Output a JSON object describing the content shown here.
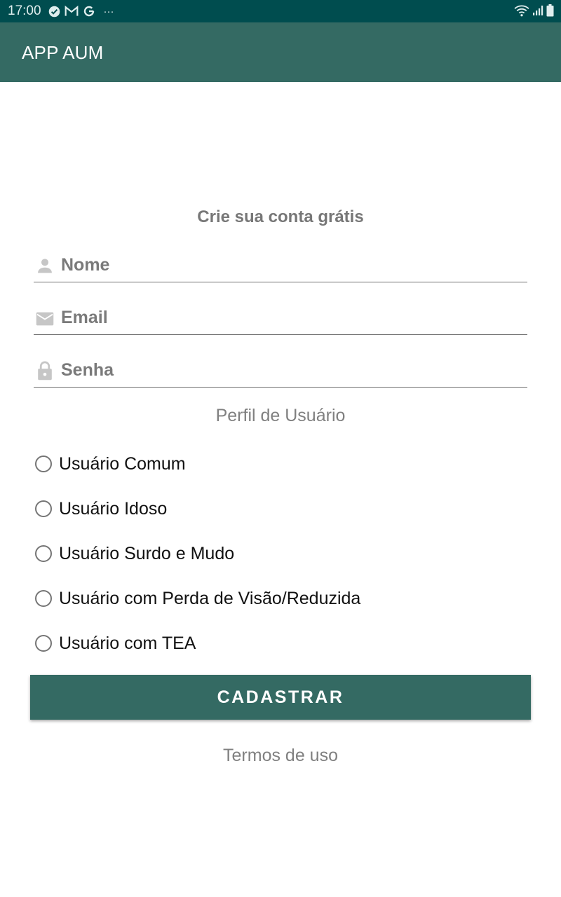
{
  "status_bar": {
    "time": "17:00",
    "left_icons": [
      "check-circle-icon",
      "gmail-icon",
      "google-icon",
      "more-dots-icon"
    ],
    "more_text": "···",
    "right_icons": [
      "wifi-icon",
      "signal-icon",
      "battery-icon"
    ]
  },
  "app_bar": {
    "title": "APP AUM",
    "color": "#346a63"
  },
  "form": {
    "title": "Crie sua conta grátis",
    "fields": [
      {
        "icon": "person-icon",
        "placeholder": "Nome",
        "value": ""
      },
      {
        "icon": "email-icon",
        "placeholder": "Email",
        "value": ""
      },
      {
        "icon": "lock-icon",
        "placeholder": "Senha",
        "value": ""
      }
    ],
    "profile_label": "Perfil de Usuário",
    "profile_options": [
      {
        "label": "Usuário Comum",
        "selected": false
      },
      {
        "label": "Usuário Idoso",
        "selected": false
      },
      {
        "label": "Usuário Surdo e Mudo",
        "selected": false
      },
      {
        "label": "Usuário com Perda de Visão/Reduzida",
        "selected": false
      },
      {
        "label": "Usuário com TEA",
        "selected": false
      }
    ],
    "submit_label": "CADASTRAR",
    "terms_label": "Termos de uso"
  },
  "colors": {
    "status_bar": "#004d4f",
    "accent": "#346a63",
    "muted_text": "#808080",
    "icon_gray": "#c6c6c6"
  }
}
